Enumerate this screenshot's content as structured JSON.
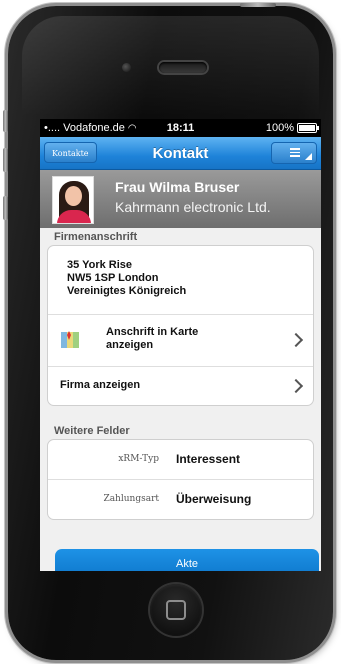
{
  "status_bar": {
    "carrier": "•.... Vodafone.de",
    "time": "18:11",
    "battery": "100%"
  },
  "nav": {
    "back_label": "Kontakte",
    "title": "Kontakt"
  },
  "contact": {
    "name": "Frau Wilma Bruser",
    "company": "Kahrmann electronic Ltd."
  },
  "address_section": {
    "label": "Firmenanschrift",
    "address_lines": [
      "35 York Rise",
      "NW5 1SP London",
      "Vereinigtes Königreich"
    ],
    "map_line1": "Anschrift in Karte",
    "map_line2": "anzeigen",
    "company_link": "Firma anzeigen"
  },
  "fields_section": {
    "label": "Weitere Felder",
    "fields": [
      {
        "key": "xRM-Typ",
        "value": "Interessent"
      },
      {
        "key": "Zahlungsart",
        "value": "Überweisung"
      }
    ]
  },
  "actions": {
    "akte_label": "Akte"
  },
  "colors": {
    "nav_blue": "#1e83d9",
    "button_blue": "#0e78cc",
    "header_gray": "#7a7a7a"
  },
  "icons": [
    "wifi-icon",
    "battery-icon",
    "menu-icon",
    "map-icon",
    "chevron-right-icon",
    "home-square-icon"
  ]
}
